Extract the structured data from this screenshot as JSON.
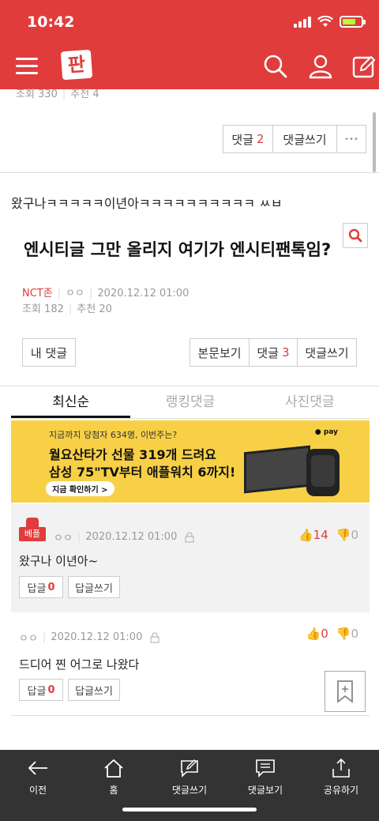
{
  "status_bar": {
    "time": "10:42"
  },
  "header": {
    "logo_text": "판",
    "brand_color": "#e03c3c"
  },
  "prev_post": {
    "views_label": "조회 330",
    "recommend_label": "추천 4",
    "comment_label": "댓글",
    "comment_count": "2",
    "write_comment_label": "댓글쓰기",
    "more_label": "•••"
  },
  "post": {
    "description": "왔구나ㅋㅋㅋㅋㅋ이년아ㅋㅋㅋㅋㅋㅋㅋㅋㅋㅋ ㅆㅂ",
    "title": "엔시티글 그만 올리지 여기가 엔시티팬톡임?",
    "category": "NCT존",
    "author": "ㅇㅇ",
    "date": "2020.12.12 01:00",
    "views": "조회 182",
    "recommends": "추천 20",
    "my_comments_label": "내 댓글",
    "view_post_label": "본문보기",
    "comment_label": "댓글",
    "comment_count": "3",
    "write_comment_label": "댓글쓰기"
  },
  "tabs": [
    {
      "label": "최신순",
      "active": true
    },
    {
      "label": "랭킹댓글",
      "active": false
    },
    {
      "label": "사진댓글",
      "active": false
    }
  ],
  "ad": {
    "line1": "지금까지 당첨자 634명, 이번주는?",
    "line2": "월요산타가 선물 319개 드려요",
    "line3": "삼성 75\"TV부터 애플워치 6까지!",
    "cta": "지금 확인하기 >",
    "pay_label": "● pay"
  },
  "comments": [
    {
      "best_label": "베플",
      "author": "ㅇㅇ",
      "date": "2020.12.12 01:00",
      "text": "왔구나 이년아~",
      "reply_label": "답글",
      "reply_count": "0",
      "write_reply_label": "답글쓰기",
      "up": "14",
      "down": "0"
    },
    {
      "author": "ㅇㅇ",
      "date": "2020.12.12 01:00",
      "text": "드디어 찐 어그로 나왔다",
      "reply_label": "답글",
      "reply_count": "0",
      "write_reply_label": "답글쓰기",
      "up": "0",
      "down": "0"
    }
  ],
  "bottom_nav": [
    {
      "label": "이전",
      "icon": "arrow-left-icon"
    },
    {
      "label": "홈",
      "icon": "home-icon"
    },
    {
      "label": "댓글쓰기",
      "icon": "write-comment-icon"
    },
    {
      "label": "댓글보기",
      "icon": "view-comments-icon"
    },
    {
      "label": "공유하기",
      "icon": "share-icon"
    }
  ]
}
